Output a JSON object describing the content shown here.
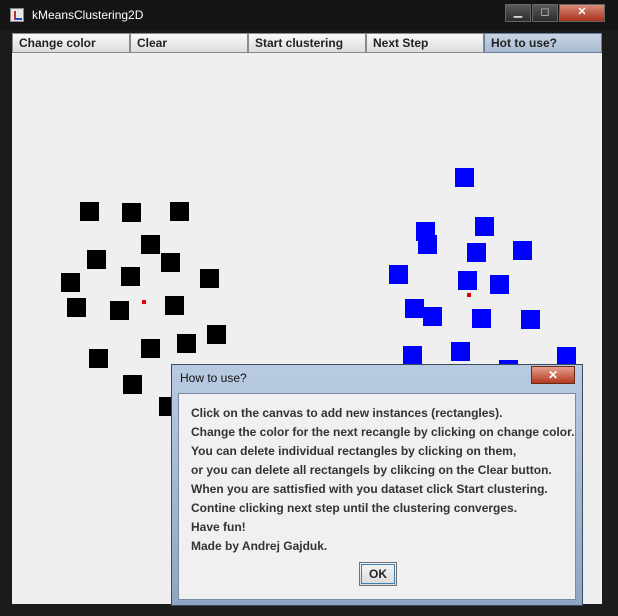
{
  "window": {
    "title": "kMeansClustering2D",
    "controls": [
      "▁",
      "◻",
      "✕"
    ]
  },
  "toolbar": {
    "buttons": [
      "Change color",
      "Clear",
      "Start clustering",
      "Next Step",
      "Hot to use?"
    ]
  },
  "colors": {
    "cluster_a": "#000000",
    "cluster_b": "#0000ff",
    "centroid": "#e00000"
  },
  "dialog": {
    "title": "How to use?",
    "close_label": "✕",
    "lines": [
      "Click on the canvas to add new instances (rectangles).",
      "Change the color for the next recangle by clicking on change color.",
      "You can delete individual rectangles by clicking on them,",
      "or you can delete all rectangels by clikcing on the Clear button.",
      "When you are sattisfied with you dataset click Start clustering.",
      "Contine clicking next step until the clustering converges.",
      "Have fun!",
      "Made by Andrej Gajduk."
    ],
    "ok_label": "OK"
  }
}
